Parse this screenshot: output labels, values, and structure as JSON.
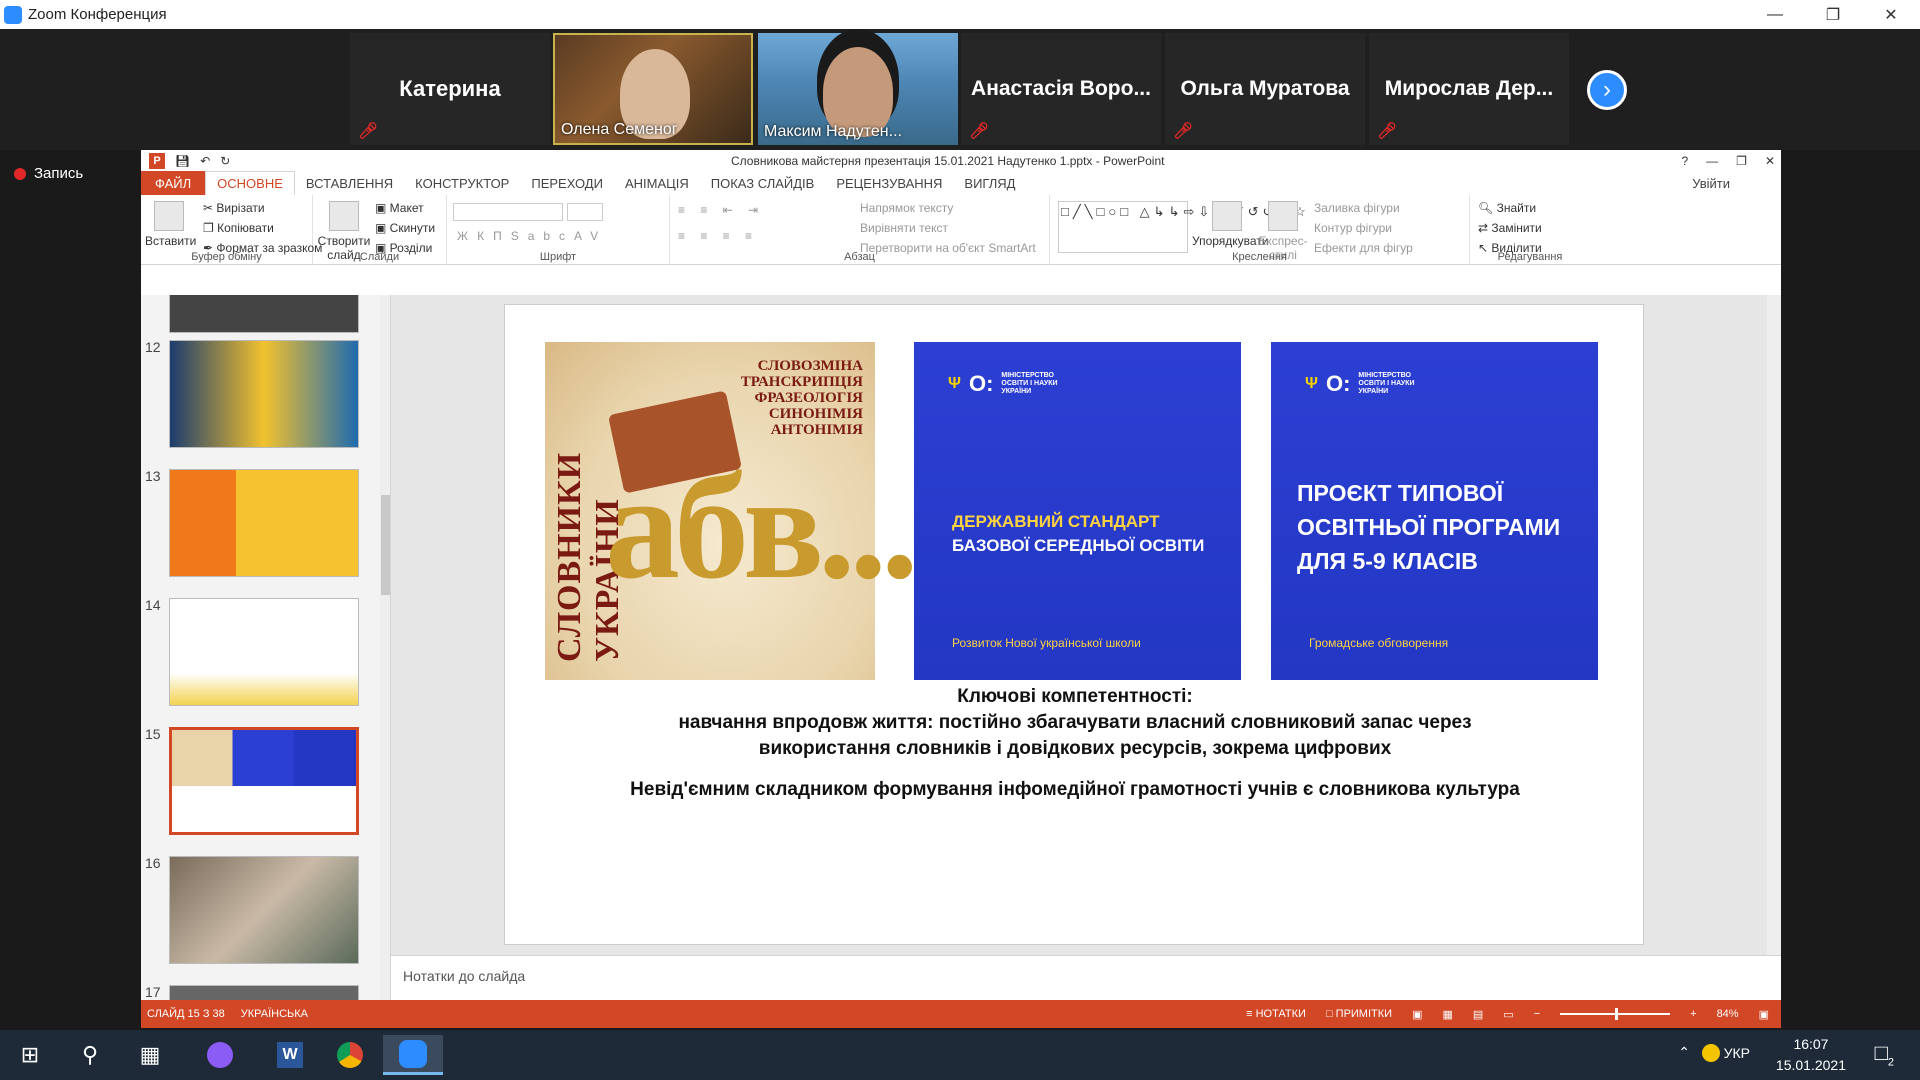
{
  "zoom": {
    "title": "Zoom Конференция",
    "record_label": "Запись"
  },
  "participants": [
    {
      "name": "Катерина",
      "video": false
    },
    {
      "name": "Олена Семеног",
      "video": true
    },
    {
      "name": "Максим Надутен...",
      "video": true
    },
    {
      "name": "Анастасія Воро...",
      "video": false
    },
    {
      "name": "Ольга Муратова",
      "video": false
    },
    {
      "name": "Мирослав Дер...",
      "video": false
    }
  ],
  "ppt": {
    "window_title": "Словникова майстерня презентація 15.01.2021 Надутенко 1.pptx - PowerPoint",
    "tabs": [
      "ФАЙЛ",
      "ОСНОВНЕ",
      "ВСТАВЛЕННЯ",
      "КОНСТРУКТОР",
      "ПЕРЕХОДИ",
      "АНІМАЦІЯ",
      "ПОКАЗ СЛАЙДІВ",
      "РЕЦЕНЗУВАННЯ",
      "ВИГЛЯД"
    ],
    "login": "Увійти",
    "ribbon": {
      "clipboard": {
        "paste": "Вставити",
        "cut": "Вирізати",
        "copy": "Копіювати",
        "format": "Формат за зразком",
        "group": "Буфер обміну"
      },
      "slides": {
        "new": "Створити слайд",
        "layout": "Макет",
        "reset": "Скинути",
        "sections": "Розділи",
        "group": "Слайди"
      },
      "font": {
        "group": "Шрифт"
      },
      "paragraph": {
        "direction": "Напрямок тексту",
        "align": "Вирівняти текст",
        "smartart": "Перетворити на об'єкт SmartArt",
        "group": "Абзац"
      },
      "drawing": {
        "arrange": "Упорядкувати",
        "quick": "Експрес-стилі",
        "fill": "Заливка фігури",
        "outline": "Контур фігури",
        "effects": "Ефекти для фігур",
        "group": "Креслення"
      },
      "editing": {
        "find": "Знайти",
        "replace": "Замінити",
        "select": "Виділити",
        "group": "Редагування"
      }
    },
    "slide_numbers": [
      "12",
      "13",
      "14",
      "15",
      "16",
      "17"
    ],
    "slide": {
      "img1_vertical": "СЛОВНИКИ УКРАЇНИ",
      "img1_words": [
        "СЛОВОЗМІНА",
        "ТРАНСКРИПЦІЯ",
        "ФРАЗЕОЛОГІЯ",
        "СИНОНІМІЯ",
        "АНТОНІМІЯ"
      ],
      "img1_big": "абв...",
      "ministry_lines": [
        "МІНІСТЕРСТВО",
        "ОСВІТИ І НАУКИ",
        "УКРАЇНИ"
      ],
      "img2_h1": "ДЕРЖАВНИЙ СТАНДАРТ",
      "img2_h2": "БАЗОВОЇ СЕРЕДНЬОЇ ОСВІТИ",
      "img2_footer": "Розвиток Нової української школи",
      "img3_h": [
        "ПРОЄКТ ТИПОВОЇ",
        "ОСВІТНЬОЇ ПРОГРАМИ",
        "ДЛЯ 5-9 КЛАСІВ"
      ],
      "img3_footer": "Громадське обговорення",
      "text1": "Ключові компетентності:",
      "text2": "навчання впродовж життя: постійно збагачувати власний словниковий запас через",
      "text3": "використання словників і довідкових ресурсів, зокрема цифрових",
      "text4": "Невід'ємним складником формування інфомедійної грамотності учнів є словникова культура"
    },
    "notes_placeholder": "Нотатки до слайда",
    "status": {
      "slide": "СЛАЙД 15 З 38",
      "lang": "УКРАЇНСЬКА",
      "notes": "НОТАТКИ",
      "comments": "ПРИМІТКИ",
      "zoom": "84%"
    }
  },
  "taskbar": {
    "lang": "УКР",
    "time": "16:07",
    "date": "15.01.2021",
    "notif_count": "2"
  }
}
